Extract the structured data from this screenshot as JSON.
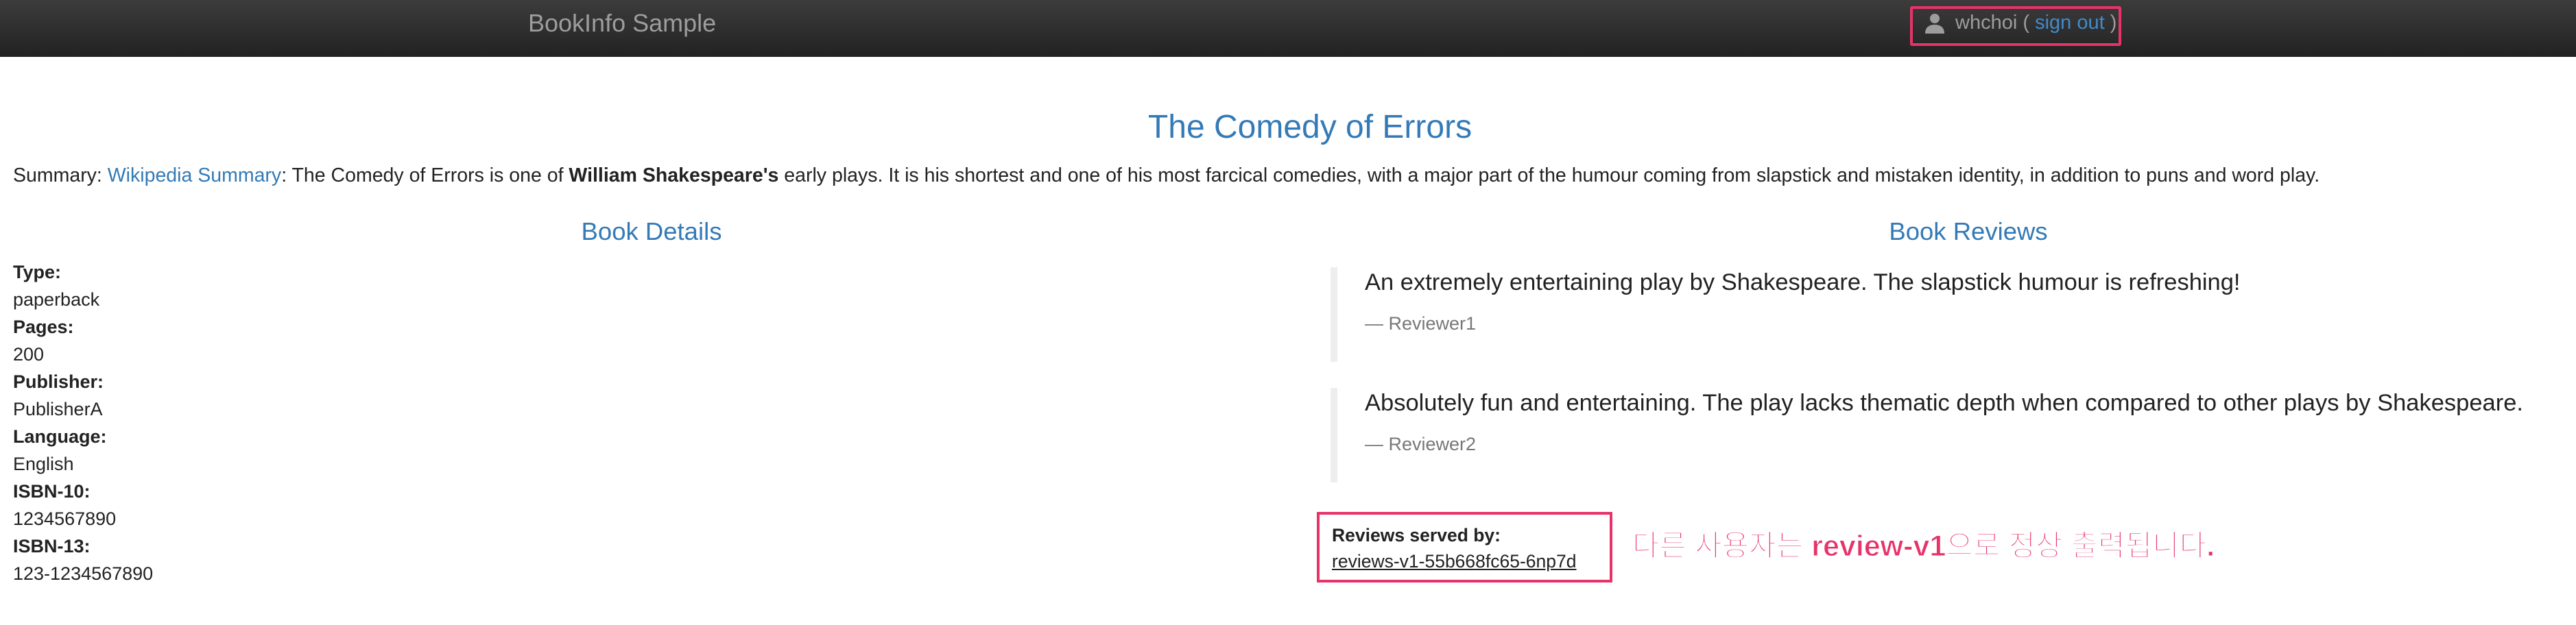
{
  "navbar": {
    "brand": "BookInfo Sample",
    "user": {
      "icon": "user-icon",
      "username": "whchoi",
      "open_paren": " ( ",
      "signout_label": "sign out",
      "close_paren": " )"
    }
  },
  "book": {
    "title": "The Comedy of Errors",
    "summary": {
      "prefix": "Summary: ",
      "link_label": "Wikipedia Summary",
      "text_1": ": The Comedy of Errors is one of ",
      "bold": "William Shakespeare's",
      "text_2": " early plays. It is his shortest and one of his most farcical comedies, with a major part of the humour coming from slapstick and mistaken identity, in addition to puns and word play."
    }
  },
  "details": {
    "heading": "Book Details",
    "fields": [
      {
        "label": "Type:",
        "value": "paperback"
      },
      {
        "label": "Pages:",
        "value": "200"
      },
      {
        "label": "Publisher:",
        "value": "PublisherA"
      },
      {
        "label": "Language:",
        "value": "English"
      },
      {
        "label": "ISBN-10:",
        "value": "1234567890"
      },
      {
        "label": "ISBN-13:",
        "value": "123-1234567890"
      }
    ]
  },
  "reviews": {
    "heading": "Book Reviews",
    "items": [
      {
        "text": "An extremely entertaining play by Shakespeare. The slapstick humour is refreshing!",
        "author": "— Reviewer1"
      },
      {
        "text": "Absolutely fun and entertaining. The play lacks thematic depth when compared to other plays by Shakespeare.",
        "author": "— Reviewer2"
      }
    ],
    "served_by_label": "Reviews served by:",
    "served_by_value": "reviews-v1-55b668fc65-6np7d"
  },
  "annotation": "다른 사용자는 review-v1으로 정상 출력됩니다.",
  "colors": {
    "navbar": "#222222",
    "link": "#337ab7",
    "highlight": "#e8336a"
  }
}
